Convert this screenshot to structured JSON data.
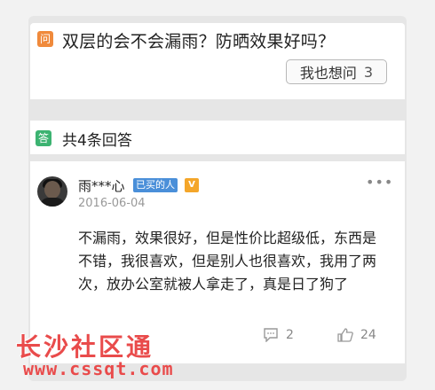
{
  "question": {
    "tag": "问",
    "title": "双层的会不会漏雨？防晒效果好吗？",
    "ask_button_label": "我也想问",
    "ask_count": "3"
  },
  "answers_header": {
    "tag": "答",
    "count_label": "共4条回答"
  },
  "answer": {
    "user_name": "雨***心",
    "buyer_badge": "已买的人",
    "level_icon": "level-badge-icon",
    "date": "2016-06-04",
    "body": "不漏雨，效果很好，但是性价比超级低，东西是不错，我很喜欢，但是别人也很喜欢，我用了两次，放办公室就被人拿走了，真是日了狗了",
    "comment_count": "2",
    "like_count": "24"
  },
  "watermark": {
    "logo_text": "长沙社区通",
    "url": "www.cssqt.com"
  },
  "colors": {
    "question_tag": "#f08a3c",
    "answer_tag": "#3cb371",
    "buyer_badge": "#4a8fd9",
    "level_icon": "#f4a62a",
    "watermark": "#e94b4b"
  }
}
